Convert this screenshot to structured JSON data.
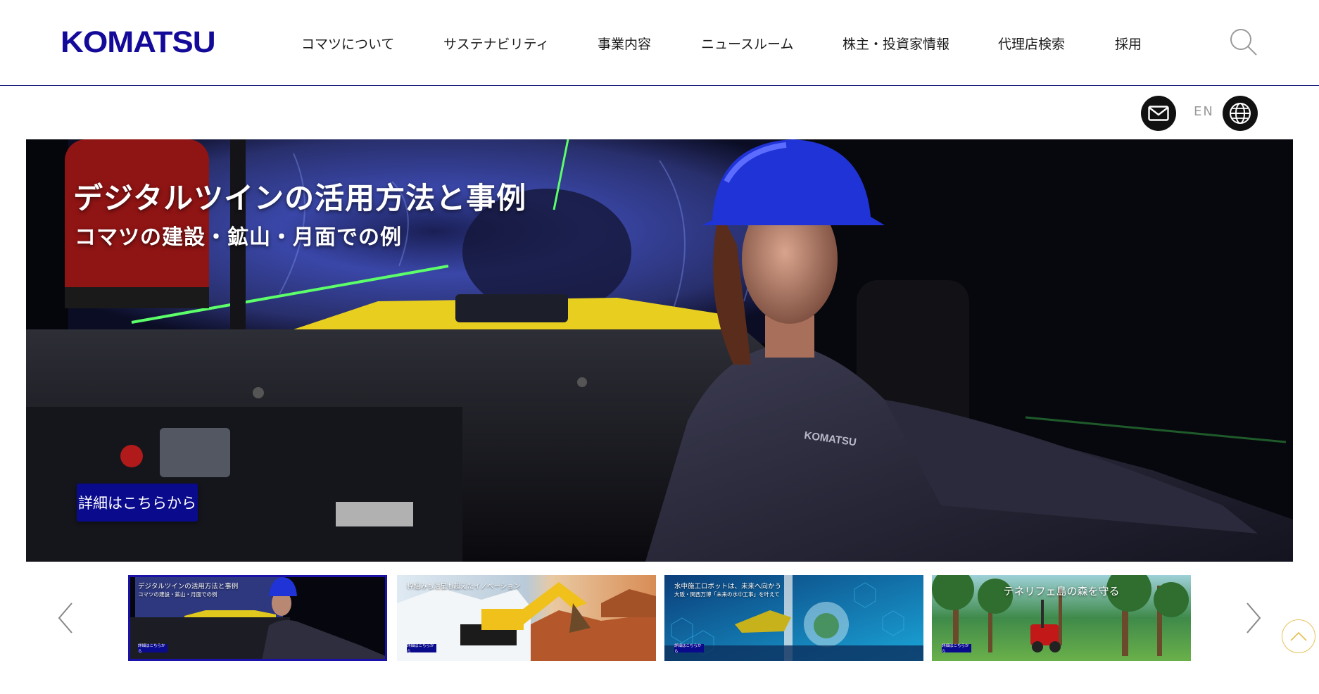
{
  "brand": {
    "logo_text": "KOMATSU",
    "color": "#140a9a"
  },
  "nav": {
    "items": [
      {
        "label": "コマツについて"
      },
      {
        "label": "サステナビリティ"
      },
      {
        "label": "事業内容"
      },
      {
        "label": "ニュースルーム"
      },
      {
        "label": "株主・投資家情報"
      },
      {
        "label": "代理店検索"
      },
      {
        "label": "採用"
      }
    ],
    "search_icon": "search-icon"
  },
  "utility": {
    "mail_icon": "mail-icon",
    "language_label": "EN",
    "globe_icon": "globe-icon"
  },
  "hero": {
    "title": "デジタルツインの活用方法と事例",
    "subtitle": "コマツの建設・鉱山・月面での例",
    "button_label": "詳細はこちらから",
    "button_color": "#0a0a8c",
    "helmet_logo": "KOMATSU"
  },
  "thumbnails": [
    {
      "caption": "デジタルツインの活用方法と事例",
      "caption2": "コマツの建設・鉱山・月面での例",
      "button_label": "詳細はこちらから",
      "active": true
    },
    {
      "caption": "枠組みも活星も超えたイノベーション",
      "caption2": "",
      "button_label": "詳細はこちらから",
      "active": false
    },
    {
      "caption": "水中施工ロボットは、未来へ向かう",
      "caption2": "大阪・関西万博「未来の水中工事」を叶えて",
      "button_label": "詳細はこちらから",
      "active": false
    },
    {
      "caption": "テネリフェ島の森を守る",
      "caption2": "",
      "button_label": "詳細はこちらから",
      "active": false
    }
  ],
  "carousel": {
    "prev_icon": "chevron-left-icon",
    "next_icon": "chevron-right-icon"
  },
  "back_to_top_icon": "chevron-up-icon"
}
